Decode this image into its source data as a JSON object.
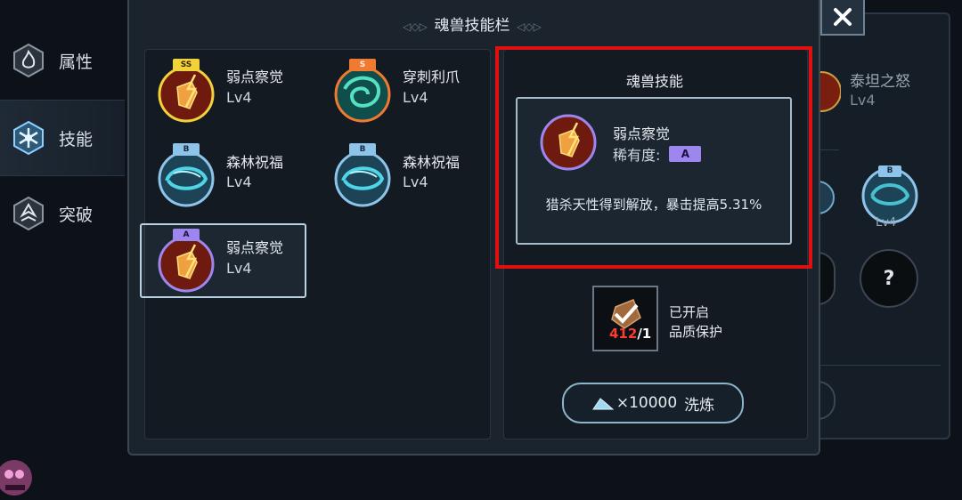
{
  "nav": {
    "items": [
      {
        "label": "属性"
      },
      {
        "label": "技能"
      },
      {
        "label": "突破"
      }
    ]
  },
  "panel": {
    "title": "魂兽技能栏"
  },
  "skills": [
    {
      "name": "弱点察觉",
      "level": "Lv4",
      "grade": "SS"
    },
    {
      "name": "穿刺利爪",
      "level": "Lv4",
      "grade": "S"
    },
    {
      "name": "森林祝福",
      "level": "Lv4",
      "grade": "B"
    },
    {
      "name": "森林祝福",
      "level": "Lv4",
      "grade": "B"
    },
    {
      "name": "弱点察觉",
      "level": "Lv4",
      "grade": "A"
    }
  ],
  "detail": {
    "heading": "魂兽技能",
    "name": "弱点察觉",
    "rarity_label": "稀有度:",
    "rarity": "A",
    "description": "猎杀天性得到解放，暴击提高5.31%"
  },
  "protection": {
    "count": "412",
    "suffix": "/1",
    "line1": "已开启",
    "line2": "品质保护"
  },
  "wash_button": {
    "cost": "×10000",
    "label": "洗炼"
  },
  "back_panel": {
    "skill_name": "泰坦之怒",
    "skill_level": "Lv4",
    "slot_badge": "B",
    "slot_level": "Lv4",
    "unknown": "?"
  },
  "colors": {
    "grade_ss": "#f2d23a",
    "grade_s": "#f07a32",
    "grade_b": "#8fc4ea",
    "grade_a": "#9d86ee",
    "highlight": "#e01010"
  }
}
